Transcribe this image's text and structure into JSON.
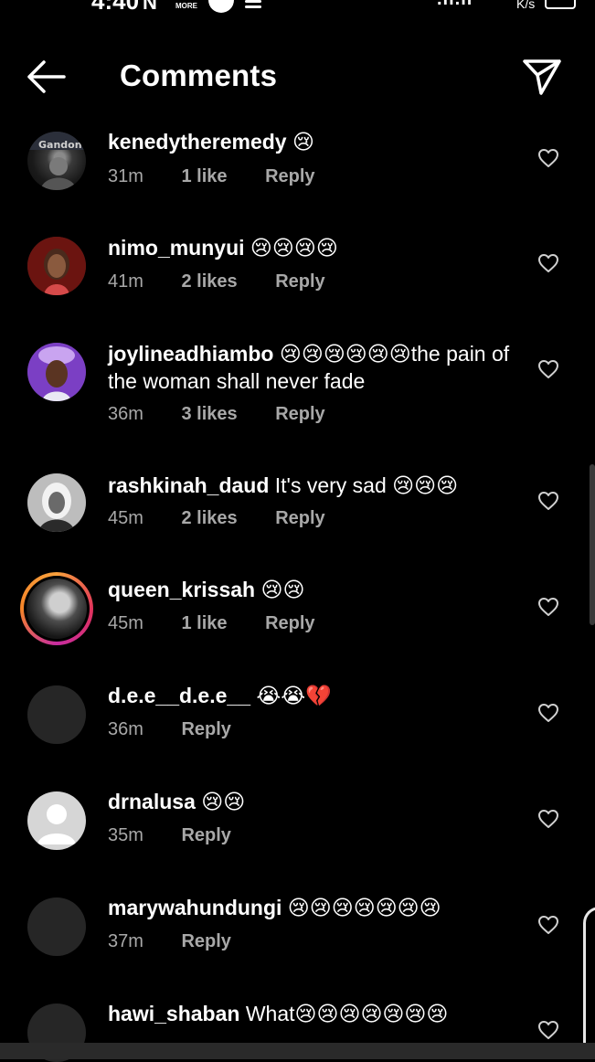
{
  "status_bar": {
    "time": "4:40",
    "more_label": "MORE",
    "speed_label": "K/s"
  },
  "header": {
    "title": "Comments"
  },
  "colors": {
    "background": "#000000",
    "text_primary": "#ffffff",
    "text_secondary": "#a8a8a8",
    "emoji_yellow": "#f5b731",
    "emoji_blue_tear": "#4aa8ff",
    "broken_heart": "#e0304a"
  },
  "comments": [
    {
      "username": "kenedytheremedy",
      "text": "",
      "emojis": "😢",
      "time": "31m",
      "likes": "1 like",
      "reply": "Reply",
      "avatar": "photo-dark"
    },
    {
      "username": "nimo_munyui",
      "text": "",
      "emojis": "😢😢😢😢",
      "time": "41m",
      "likes": "2 likes",
      "reply": "Reply",
      "avatar": "photo-red"
    },
    {
      "username": "joylineadhiambo",
      "text": "the pain of the woman shall never fade",
      "emojis": "😢😢😢😢😢😢",
      "time": "36m",
      "likes": "3 likes",
      "reply": "Reply",
      "avatar": "photo-purple"
    },
    {
      "username": "rashkinah_daud",
      "text": "It's very sad",
      "emojis": "😢😢😢",
      "time": "45m",
      "likes": "2 likes",
      "reply": "Reply",
      "avatar": "photo-gray"
    },
    {
      "username": "queen_krissah",
      "text": "",
      "emojis": "😢😢",
      "time": "45m",
      "likes": "1 like",
      "reply": "Reply",
      "avatar": "story-ring"
    },
    {
      "username": "d.e.e__d.e.e__",
      "text": "",
      "emojis": "😭😭💔",
      "time": "36m",
      "likes": "",
      "reply": "Reply",
      "avatar": "empty"
    },
    {
      "username": "drnalusa",
      "text": "",
      "emojis": "😢😢",
      "time": "35m",
      "likes": "",
      "reply": "Reply",
      "avatar": "default-person"
    },
    {
      "username": "marywahundungi",
      "text": "",
      "emojis": "😢😢😢😢😢😢😢",
      "time": "37m",
      "likes": "",
      "reply": "Reply",
      "avatar": "empty"
    },
    {
      "username": "hawi_shaban",
      "text": "What",
      "emojis": "😢😢😢😢😢😢😢",
      "time": "",
      "likes": "",
      "reply": "",
      "avatar": "empty"
    }
  ]
}
